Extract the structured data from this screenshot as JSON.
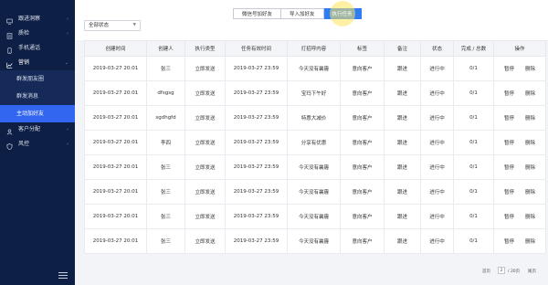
{
  "sidebar": {
    "items": [
      {
        "label": "跟进洞察",
        "icon": "monitor-icon",
        "chevron": "›"
      },
      {
        "label": "质检",
        "icon": "checklist-icon",
        "chevron": "›"
      },
      {
        "label": "手机通话",
        "icon": "phone-icon",
        "chevron": ""
      },
      {
        "label": "营销",
        "icon": "chart-icon",
        "chevron": "⌄"
      }
    ],
    "sub_items": [
      {
        "label": "群发朋友圈"
      },
      {
        "label": "群发消息"
      },
      {
        "label": "主动加好友"
      }
    ],
    "items_after": [
      {
        "label": "客户分配",
        "icon": "users-icon",
        "chevron": "›"
      },
      {
        "label": "风控",
        "icon": "shield-icon",
        "chevron": "›"
      }
    ]
  },
  "tabs": [
    {
      "label": "微信号加好友"
    },
    {
      "label": "导入加好友"
    },
    {
      "label": "执行任务"
    }
  ],
  "filter": {
    "value": "全部状态"
  },
  "table": {
    "headers": [
      "创建时间",
      "创建人",
      "执行类型",
      "任务有效时间",
      "打招呼内容",
      "标签",
      "备注",
      "状态",
      "完成 / 总数",
      "操作"
    ],
    "rows": [
      [
        "2019-03-27 20:01",
        "张三",
        "立即发送",
        "2019-03-27 23:59",
        "今天没有襄霾",
        "意向客户",
        "跟进",
        "进行中",
        "0/1"
      ],
      [
        "2019-03-27 20:01",
        "dfsgsg",
        "立即发送",
        "2019-03-27 23:59",
        "宝玛下午好",
        "意向客户",
        "跟进",
        "进行中",
        "0/1"
      ],
      [
        "2019-03-27 20:01",
        "sgdhgfd",
        "立即发送",
        "2019-03-27 23:59",
        "特惠大减价",
        "意向客户",
        "跟进",
        "进行中",
        "0/1"
      ],
      [
        "2019-03-27 20:01",
        "李四",
        "立即发送",
        "2019-03-27 23:59",
        "分享有优惠",
        "意向客户",
        "跟进",
        "进行中",
        "0/1"
      ],
      [
        "2019-03-27 20:01",
        "张三",
        "立即发送",
        "2019-03-27 23:59",
        "今天没有襄霾",
        "意向客户",
        "跟进",
        "进行中",
        "0/1"
      ],
      [
        "2019-03-27 20:01",
        "张三",
        "立即发送",
        "2019-03-27 23:59",
        "今天没有襄霾",
        "意向客户",
        "跟进",
        "进行中",
        "0/1"
      ],
      [
        "2019-03-27 20:01",
        "张三",
        "立即发送",
        "2019-03-27 23:59",
        "今天没有襄霾",
        "意向客户",
        "跟进",
        "进行中",
        "0/1"
      ],
      [
        "2019-03-27 20:01",
        "张三",
        "立即发送",
        "2019-03-27 23:59",
        "今天没有襄霾",
        "意向客户",
        "跟进",
        "进行中",
        "0/1"
      ]
    ],
    "actions": [
      "暂停",
      "删除"
    ]
  },
  "pager": {
    "prev": "首页",
    "page": "2",
    "total": "/ 20页",
    "next": "尾页"
  },
  "colors": {
    "sidebar_bg": "#0e1f45",
    "active_item": "#3366f0",
    "tab_active": "#2f7cf6",
    "highlight": "#ffe65a"
  }
}
